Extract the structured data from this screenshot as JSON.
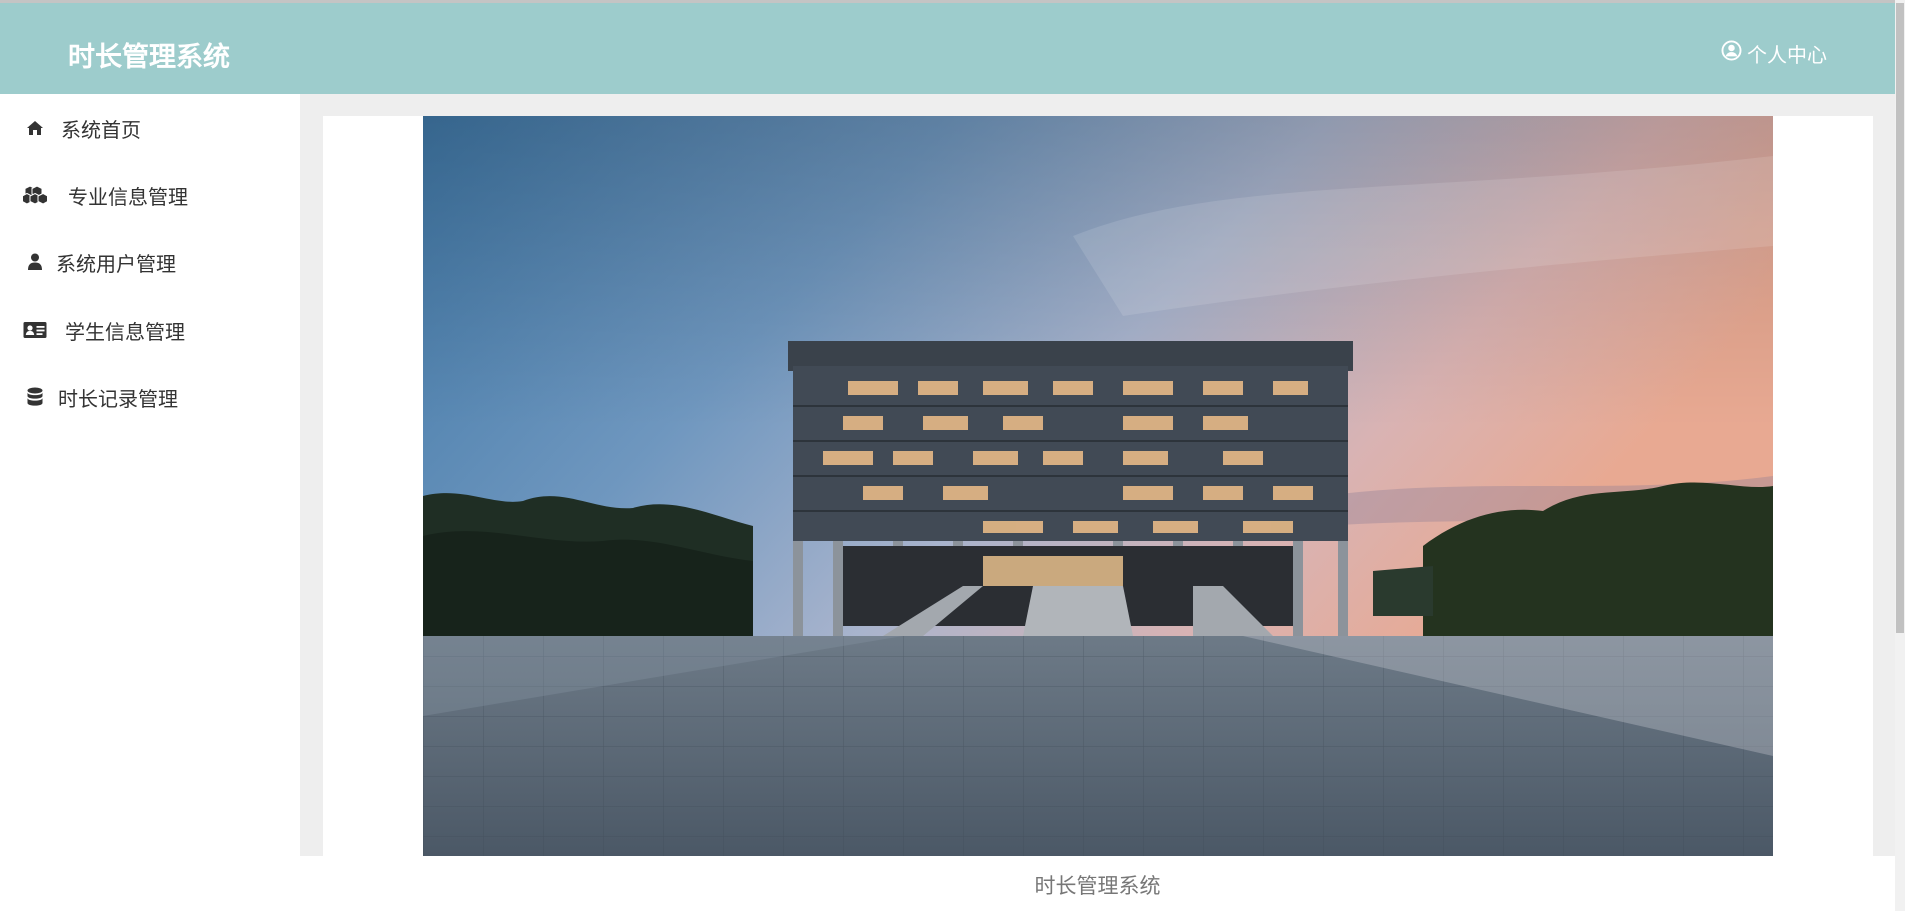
{
  "header": {
    "brand": "时长管理系统",
    "user_center_label": "个人中心",
    "user_icon": "user-circle-icon",
    "background_color": "#9dcccc"
  },
  "sidebar": {
    "items": [
      {
        "label": "系统首页",
        "icon": "home-icon"
      },
      {
        "label": "专业信息管理",
        "icon": "cubes-icon"
      },
      {
        "label": "系统用户管理",
        "icon": "user-icon"
      },
      {
        "label": "学生信息管理",
        "icon": "id-card-icon"
      },
      {
        "label": "时长记录管理",
        "icon": "database-icon"
      }
    ]
  },
  "main": {
    "banner_image": "campus-building-photo"
  },
  "footer": {
    "text": "时长管理系统"
  }
}
